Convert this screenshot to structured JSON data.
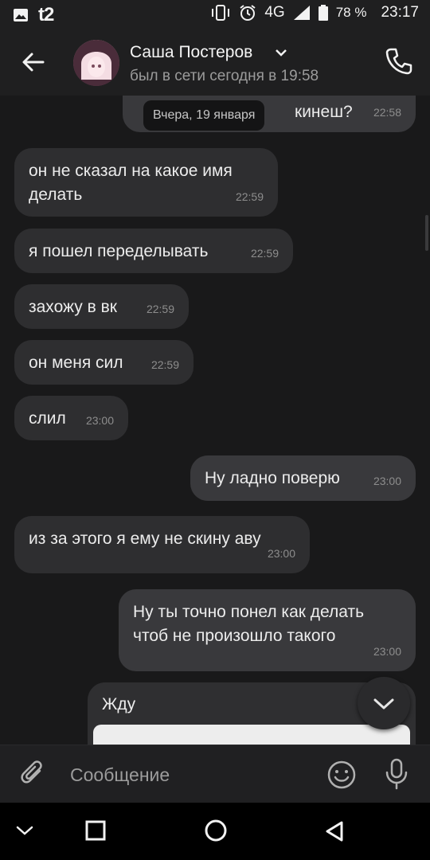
{
  "status_bar": {
    "carrier": "t2",
    "network": "4G",
    "battery": "78 %",
    "time": "23:17"
  },
  "header": {
    "contact_name": "Саша Постеров",
    "last_seen": "был в сети сегодня в 19:58"
  },
  "chat": {
    "date_separator": "Вчера, 19 января",
    "partial_message_text": "кинеш?",
    "partial_message_time": "22:58",
    "messages": [
      {
        "direction": "in",
        "text_lines": [
          "он не сказал на какое имя",
          "делать"
        ],
        "time": "22:59"
      },
      {
        "direction": "in",
        "text": "я пошел переделывать",
        "time": "22:59"
      },
      {
        "direction": "in",
        "text": "захожу в вк",
        "time": "22:59"
      },
      {
        "direction": "in",
        "text": "он меня сил",
        "time": "22:59"
      },
      {
        "direction": "in",
        "text": "слил",
        "time": "23:00"
      },
      {
        "direction": "out",
        "text": "Ну ладно поверю",
        "time": "23:00"
      },
      {
        "direction": "in",
        "text": "из за этого я ему не скину аву",
        "time": "23:00"
      },
      {
        "direction": "out",
        "text_lines": [
          "Ну ты точно понел как делать",
          "чтоб не произошло такого"
        ],
        "time": "23:00"
      },
      {
        "direction": "out",
        "text": "Жду",
        "type": "attachment_card"
      }
    ]
  },
  "composer": {
    "placeholder": "Сообщение"
  },
  "icons": {
    "back": "arrow-left-icon",
    "phone": "phone-icon",
    "attach": "paperclip-icon",
    "emoji": "smile-icon",
    "mic": "microphone-icon",
    "scroll_down": "chevron-down-icon"
  },
  "colors": {
    "background": "#19191a",
    "bubble_in": "#2e2e30",
    "bubble_out": "#39393c"
  }
}
